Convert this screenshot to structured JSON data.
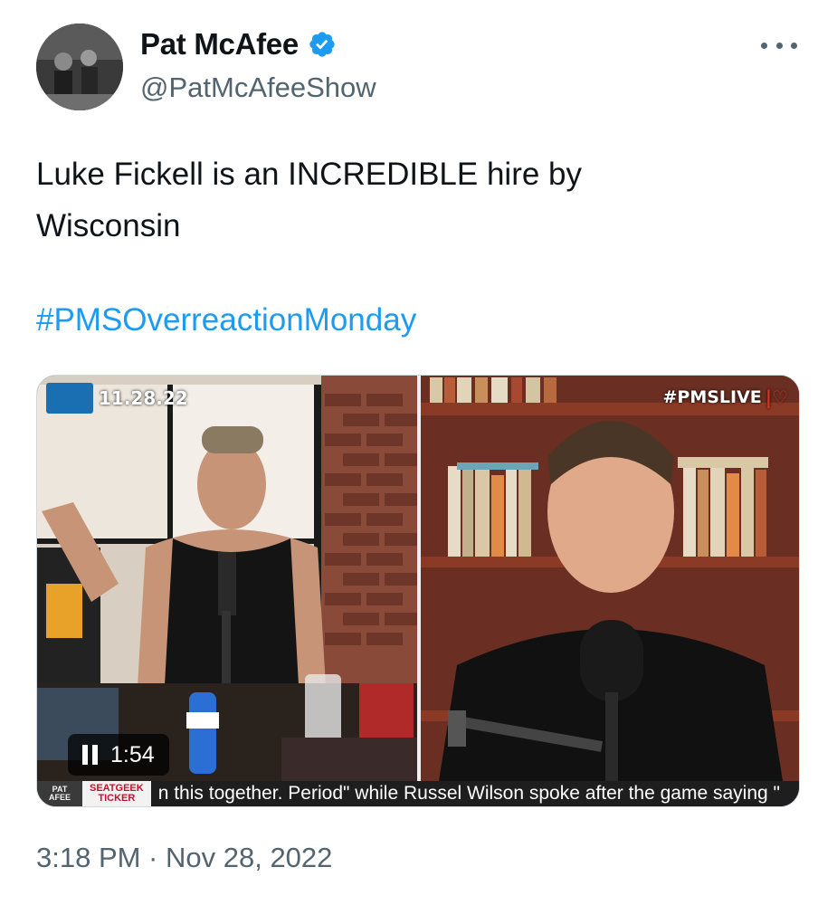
{
  "tweet": {
    "author": {
      "display_name": "Pat McAfee",
      "handle": "@PatMcAfeeShow",
      "verified": true
    },
    "text": "Luke Fickell is an INCREDIBLE hire by Wisconsin",
    "hashtag": "#PMSOverreactionMonday",
    "timestamp": "3:18 PM · Nov 28, 2022"
  },
  "video": {
    "date_overlay": "11.28.22",
    "live_tag": "#PMSLIVE",
    "duration": "1:54",
    "state": "playing",
    "ticker": {
      "sponsor_line1": "SEATGEEK",
      "sponsor_line2": "TICKER",
      "text": "n this together. Period\" while Russel Wilson spoke after the game saying \""
    }
  },
  "colors": {
    "text_primary": "#0f1419",
    "text_secondary": "#536471",
    "link": "#1d9bf0",
    "verified_badge": "#1d9bf0"
  },
  "icons": {
    "verified": "verified-badge-icon",
    "more": "more-options-icon",
    "pause": "pause-icon"
  }
}
